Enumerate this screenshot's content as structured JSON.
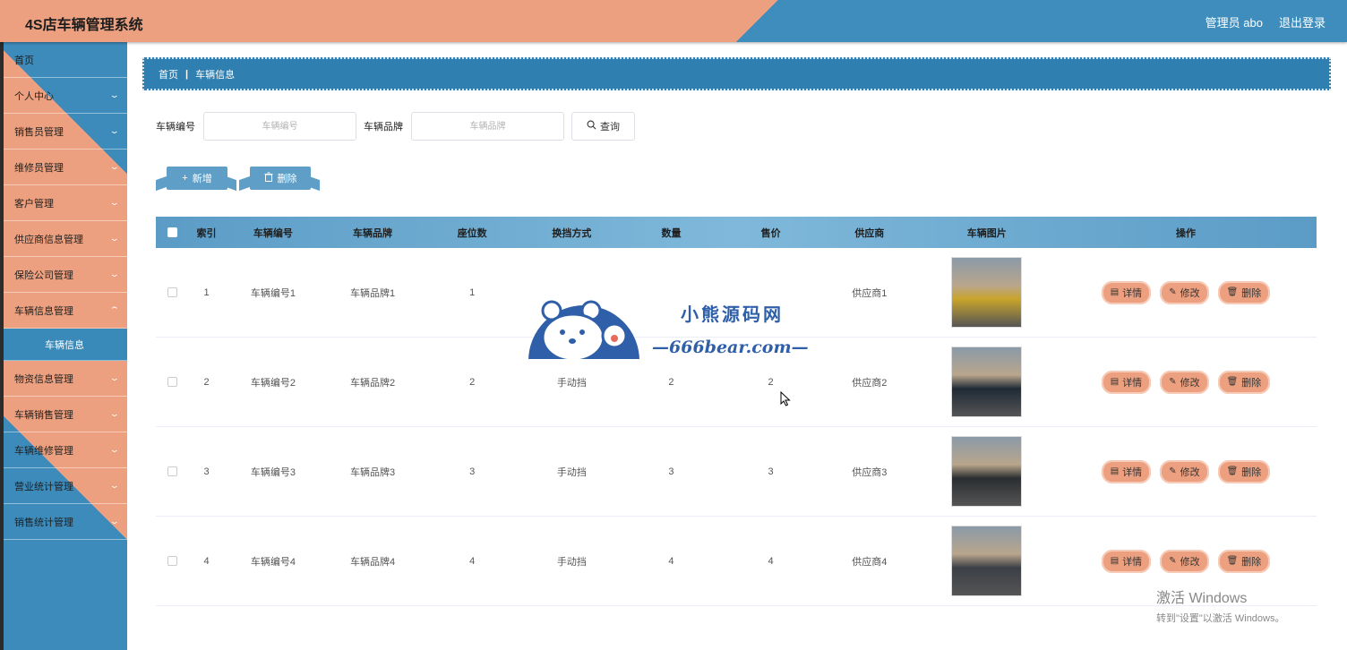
{
  "header": {
    "title": "4S店车辆管理系统",
    "user": "管理员 abo",
    "logout": "退出登录"
  },
  "sidebar": {
    "items": [
      {
        "label": "首页",
        "chevron": false
      },
      {
        "label": "个人中心",
        "chevron": true
      },
      {
        "label": "销售员管理",
        "chevron": true
      },
      {
        "label": "维修员管理",
        "chevron": true
      },
      {
        "label": "客户管理",
        "chevron": true
      },
      {
        "label": "供应商信息管理",
        "chevron": true
      },
      {
        "label": "保险公司管理",
        "chevron": true
      },
      {
        "label": "车辆信息管理",
        "chevron": true,
        "expanded": true
      }
    ],
    "submenu": {
      "label": "车辆信息"
    },
    "items_after": [
      {
        "label": "物资信息管理",
        "chevron": true
      },
      {
        "label": "车辆销售管理",
        "chevron": true
      },
      {
        "label": "车辆维修管理",
        "chevron": true
      },
      {
        "label": "营业统计管理",
        "chevron": true
      },
      {
        "label": "销售统计管理",
        "chevron": true
      }
    ]
  },
  "breadcrumb": {
    "home": "首页",
    "current": "车辆信息"
  },
  "search": {
    "field1_label": "车辆编号",
    "field1_placeholder": "车辆编号",
    "field2_label": "车辆品牌",
    "field2_placeholder": "车辆品牌",
    "query_label": "查询"
  },
  "actions": {
    "add_label": "新增",
    "delete_label": "删除"
  },
  "table": {
    "headers": [
      "索引",
      "车辆编号",
      "车辆品牌",
      "座位数",
      "换挡方式",
      "数量",
      "售价",
      "供应商",
      "车辆图片",
      "操作"
    ],
    "rows": [
      {
        "idx": "1",
        "no": "车辆编号1",
        "brand": "车辆品牌1",
        "seats": "1",
        "gear": "",
        "qty": "",
        "price": "",
        "supplier": "供应商1",
        "img_color": "#c9a42a"
      },
      {
        "idx": "2",
        "no": "车辆编号2",
        "brand": "车辆品牌2",
        "seats": "2",
        "gear": "手动挡",
        "qty": "2",
        "price": "2",
        "supplier": "供应商2",
        "img_color": "#1f2a36"
      },
      {
        "idx": "3",
        "no": "车辆编号3",
        "brand": "车辆品牌3",
        "seats": "3",
        "gear": "手动挡",
        "qty": "3",
        "price": "3",
        "supplier": "供应商3",
        "img_color": "#2a2d31"
      },
      {
        "idx": "4",
        "no": "车辆编号4",
        "brand": "车辆品牌4",
        "seats": "4",
        "gear": "手动挡",
        "qty": "4",
        "price": "4",
        "supplier": "供应商4",
        "img_color": "#3b3f46"
      }
    ],
    "op_detail": "详情",
    "op_edit": "修改",
    "op_delete": "删除"
  },
  "watermark": {
    "title": "小熊源码网",
    "site": "—666bear.com—"
  },
  "windows": {
    "line1": "激活 Windows",
    "line2": "转到\"设置\"以激活 Windows。"
  },
  "colors": {
    "salmon": "#eda07f",
    "blue": "#3f8dbd"
  }
}
